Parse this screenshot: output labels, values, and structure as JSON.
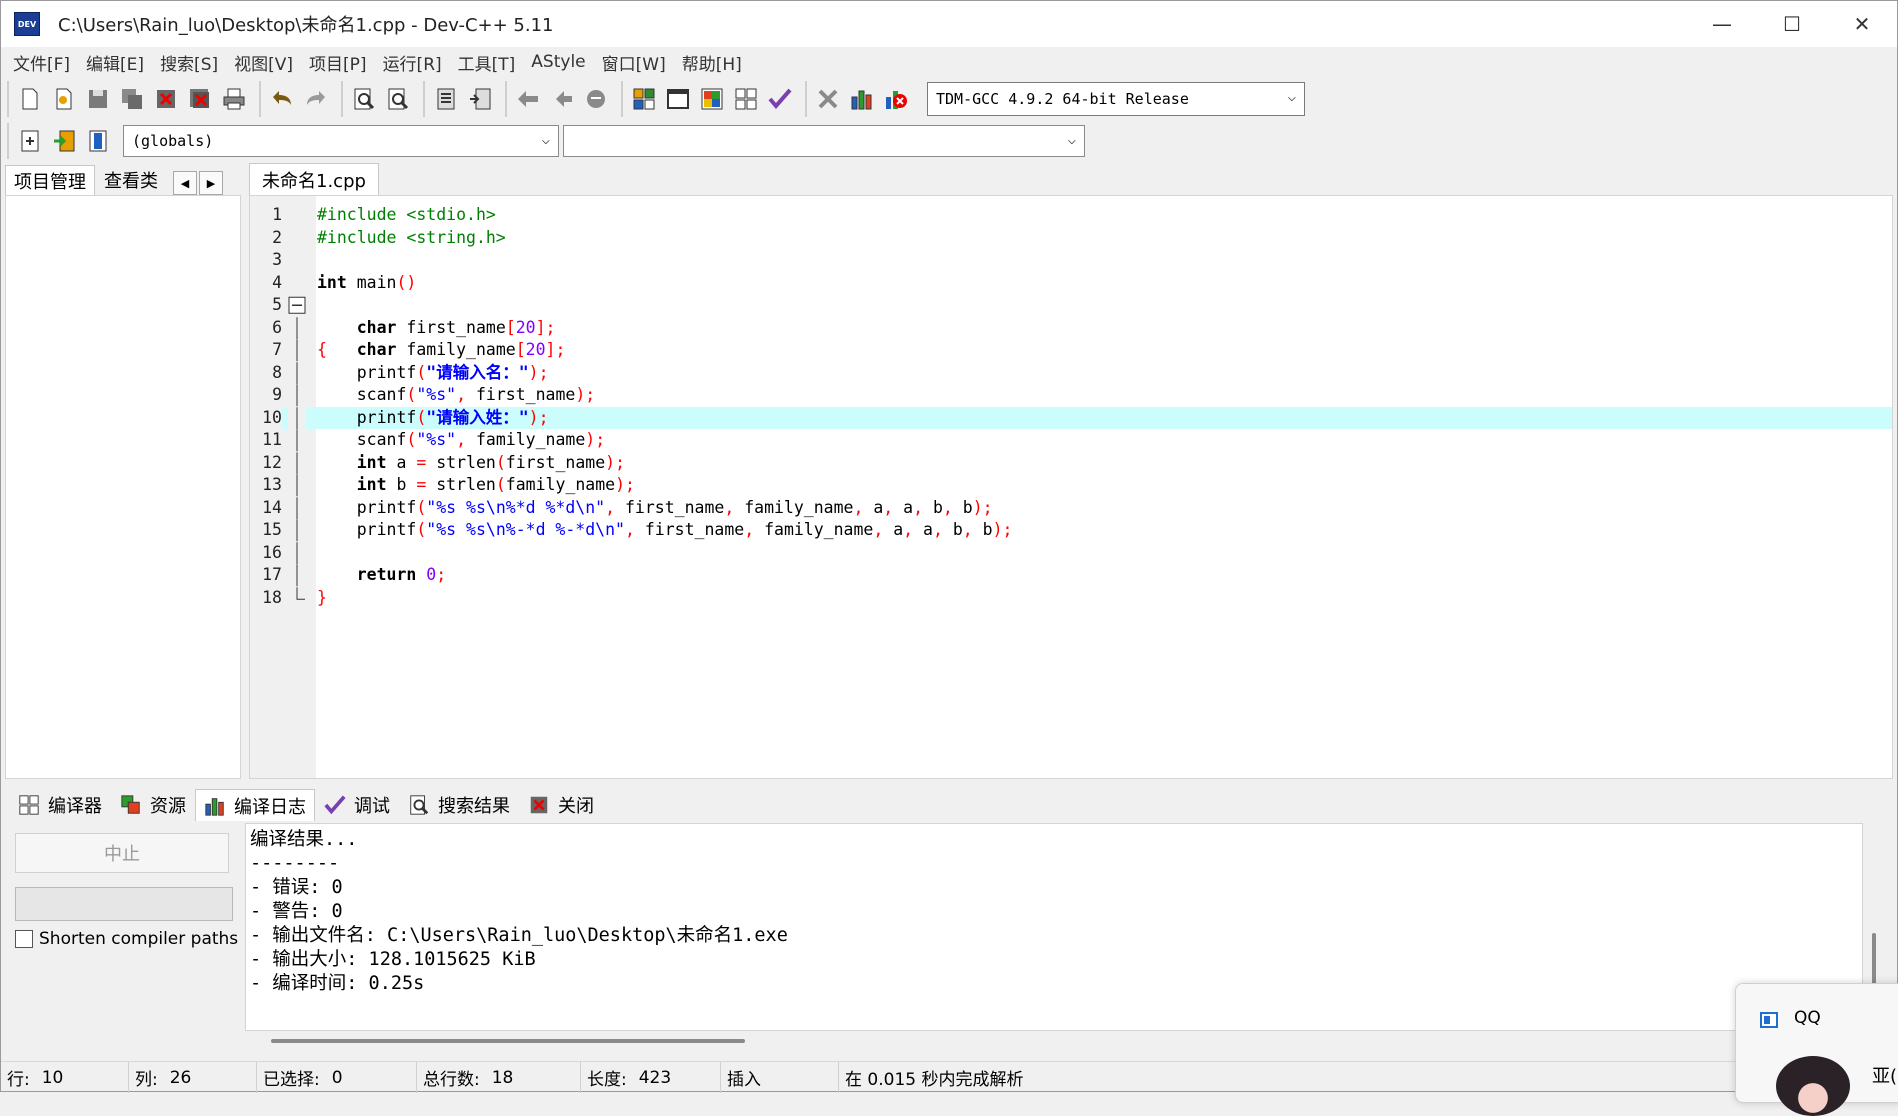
{
  "window": {
    "title": "C:\\Users\\Rain_luo\\Desktop\\未命名1.cpp - Dev-C++ 5.11",
    "icon_label": "DEV",
    "minimize": "—",
    "maximize": "☐",
    "close": "✕"
  },
  "menu": [
    "文件[F]",
    "编辑[E]",
    "搜索[S]",
    "视图[V]",
    "项目[P]",
    "运行[R]",
    "工具[T]",
    "AStyle",
    "窗口[W]",
    "帮助[H]"
  ],
  "toolbar": {
    "compiler": "TDM-GCC 4.9.2 64-bit Release",
    "scope": "(globals)",
    "member": ""
  },
  "left_panel": {
    "tabs": [
      "项目管理",
      "查看类"
    ],
    "prev": "◀",
    "next": "▶"
  },
  "editor": {
    "tab": "未命名1.cpp",
    "current_line": 10,
    "highlight_color": "#ccfdfd",
    "lines": [
      {
        "n": "1"
      },
      {
        "n": "2"
      },
      {
        "n": "3"
      },
      {
        "n": "4"
      },
      {
        "n": "5"
      },
      {
        "n": "6"
      },
      {
        "n": "7"
      },
      {
        "n": "8"
      },
      {
        "n": "9"
      },
      {
        "n": "10"
      },
      {
        "n": "11"
      },
      {
        "n": "12"
      },
      {
        "n": "13"
      },
      {
        "n": "14"
      },
      {
        "n": "15"
      },
      {
        "n": "16"
      },
      {
        "n": "17"
      },
      {
        "n": "18"
      }
    ],
    "code": {
      "l1": "#include <stdio.h>",
      "l2": "#include <string.h>",
      "l4_kw": "int",
      "l4_id": " main",
      "l4_sym": "()",
      "l5_sym": "{",
      "l6_kw": "char",
      "l6_id": " first_name",
      "l6_sym1": "[",
      "l6_num": "20",
      "l6_sym2": "];",
      "l7_kw": "char",
      "l7_id": " family_name",
      "l7_sym1": "[",
      "l7_num": "20",
      "l7_sym2": "];",
      "l8_id": "printf",
      "l8_sym1": "(",
      "l8_str": "\"请输入名：\"",
      "l8_sym2": ");",
      "l9_id": "scanf",
      "l9_sym1": "(",
      "l9_str": "\"%s\"",
      "l9_sym2": ",",
      "l9_id2": " first_name",
      "l9_sym3": ");",
      "l10_id": "printf",
      "l10_sym1": "(",
      "l10_str": "\"请输入姓：\"",
      "l10_sym2": ");",
      "l11_id": "scanf",
      "l11_sym1": "(",
      "l11_str": "\"%s\"",
      "l11_sym2": ",",
      "l11_id2": " family_name",
      "l11_sym3": ");",
      "l12_kw": "int",
      "l12_id": " a ",
      "l12_sym1": "=",
      "l12_id2": " strlen",
      "l12_sym2": "(",
      "l12_id3": "first_name",
      "l12_sym3": ");",
      "l13_kw": "int",
      "l13_id": " b ",
      "l13_sym1": "=",
      "l13_id2": " strlen",
      "l13_sym2": "(",
      "l13_id3": "family_name",
      "l13_sym3": ");",
      "l14_id": "printf",
      "l14_sym1": "(",
      "l14_str": "\"%s %s\\n%*d %*d\\n\"",
      "l14_sym2": ",",
      "l14_id2": " first_name",
      "l14_sym3": ",",
      "l14_id3": " family_name",
      "l14_sym4": ",",
      "l14_id4": " a",
      "l14_sym5": ",",
      "l14_id5": " a",
      "l14_sym6": ",",
      "l14_id6": " b",
      "l14_sym7": ",",
      "l14_id7": " b",
      "l14_sym8": ");",
      "l15_id": "printf",
      "l15_sym1": "(",
      "l15_str": "\"%s %s\\n%-*d %-*d\\n\"",
      "l15_sym2": ",",
      "l15_id2": " first_name",
      "l15_sym3": ",",
      "l15_id3": " family_name",
      "l15_sym4": ",",
      "l15_id4": " a",
      "l15_sym5": ",",
      "l15_id5": " a",
      "l15_sym6": ",",
      "l15_id6": " b",
      "l15_sym7": ",",
      "l15_id7": " b",
      "l15_sym8": ");",
      "l17_kw": "return",
      "l17_num": " 0",
      "l17_sym": ";",
      "l18_sym": "}"
    }
  },
  "bottom_tabs": [
    "编译器",
    "资源",
    "编译日志",
    "调试",
    "搜索结果",
    "关闭"
  ],
  "bottom_left": {
    "stop": "中止",
    "shorten": "Shorten compiler paths"
  },
  "log": [
    "编译结果...",
    "--------",
    "- 错误: 0",
    "- 警告: 0",
    "- 输出文件名: C:\\Users\\Rain_luo\\Desktop\\未命名1.exe",
    "- 输出大小: 128.1015625 KiB",
    "- 编译时间: 0.25s"
  ],
  "status": {
    "row_label": "行:",
    "row": "10",
    "col_label": "列:",
    "col": "26",
    "sel_label": "已选择:",
    "sel": "0",
    "total_label": "总行数:",
    "total": "18",
    "len_label": "长度:",
    "len": "423",
    "mode": "插入",
    "parse": "在 0.015 秒内完成解析"
  },
  "notification": {
    "title": "QQ",
    "name": "亚("
  }
}
